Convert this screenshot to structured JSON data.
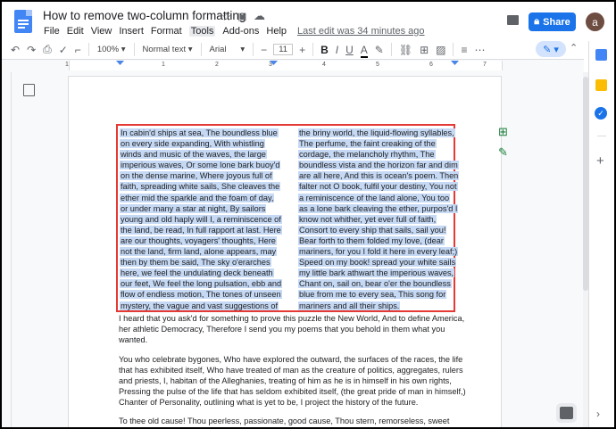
{
  "window": {
    "doc_title": "How to remove two-column formatting",
    "last_edit": "Last edit was 34 minutes ago",
    "share_label": "Share",
    "avatar_initial": "a"
  },
  "menu": {
    "items": [
      "File",
      "Edit",
      "View",
      "Insert",
      "Format",
      "Tools",
      "Add-ons",
      "Help"
    ],
    "active": "Tools"
  },
  "toolbar": {
    "zoom": "100%",
    "style": "Normal text",
    "font": "Arial",
    "font_size": "11",
    "bold": "B",
    "italic": "I",
    "underline": "U",
    "text_color": "A"
  },
  "ruler": {
    "ticks": [
      "1",
      "1",
      "2",
      "3",
      "4",
      "5",
      "6",
      "7"
    ]
  },
  "document": {
    "left_column": [
      "In cabin'd ships at sea, The boundless blue",
      "on every side expanding, With whistling",
      "winds and music of the waves, the large",
      "imperious waves, Or some lone bark buoy'd",
      "on the dense marine, Where joyous full of",
      "faith, spreading white sails, She cleaves the",
      "ether mid the sparkle and the foam of day,",
      "or under many a star at night, By sailors",
      "young and old haply will I, a reminiscence of",
      "the land, be read, In full rapport at last. Here",
      "are our thoughts, voyagers' thoughts, Here",
      "not the land, firm land, alone appears, may",
      "then by them be said, The sky o'erarches",
      "here, we feel the undulating deck beneath",
      "our feet, We feel the long pulsation, ebb and",
      "flow of endless motion, The tones of unseen",
      "mystery, the vague and vast suggestions of"
    ],
    "right_column": [
      "the briny world, the liquid-flowing syllables,",
      "The perfume, the faint creaking of the",
      "cordage, the melancholy rhythm, The",
      "boundless vista and the horizon far and dim",
      "are all here, And this is ocean's poem. Then",
      "falter not O book, fulfil your destiny, You not",
      "a reminiscence of the land alone, You too",
      "as a lone bark cleaving the ether, purpos'd I",
      "know not whither, yet ever full of faith,",
      "Consort to every ship that sails, sail you!",
      "Bear forth to them folded my love, (dear",
      "mariners, for you I fold it here in every leaf;)",
      "Speed on my book! spread your white sails",
      "my little bark athwart the imperious waves,",
      "Chant on, sail on, bear o'er the boundless",
      "blue from me to every sea, This song for",
      "mariners and all their ships."
    ],
    "para1": [
      "I heard that you ask'd for something to prove this puzzle the New World, And to define America,",
      "her athletic Democracy, Therefore I send you my poems that you behold in them what you",
      "wanted."
    ],
    "para2": [
      "You who celebrate bygones, Who have explored the outward, the surfaces of the races, the life",
      "that has exhibited itself, Who have treated of man as the creature of politics, aggregates, rulers",
      "and priests, I, habitan of the Alleghanies, treating of him as he is in himself in his own rights,",
      "Pressing the pulse of the life that has seldom exhibited itself, (the great pride of man in himself,)",
      "Chanter of Personality, outlining what is yet to be, I project the history of the future."
    ],
    "para3": [
      "To thee old cause! Thou peerless, passionate, good cause, Thou stern, remorseless, sweet"
    ]
  },
  "colors": {
    "accent": "#1a73e8",
    "selection": "#c6d9f4",
    "highlight_box": "#e53935"
  },
  "icons": [
    "docs-logo",
    "star-icon",
    "move-icon",
    "cloud-icon",
    "comment-icon",
    "lock-icon",
    "undo-icon",
    "redo-icon",
    "print-icon",
    "spellcheck-icon",
    "paint-format-icon",
    "link-icon",
    "insert-comment-icon",
    "image-icon",
    "align-icon",
    "edit-mode-icon",
    "outline-icon",
    "add-comment-icon",
    "suggest-edit-icon",
    "explore-icon",
    "calendar-icon",
    "keep-icon",
    "tasks-icon",
    "add-icon"
  ]
}
